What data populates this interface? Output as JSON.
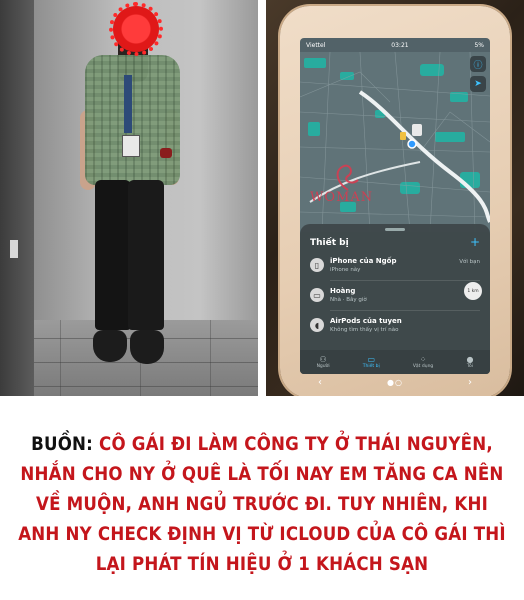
{
  "phone": {
    "status": {
      "carrier": "Viettel",
      "time": "03:21",
      "battery": "5%"
    },
    "map_watermark": "WOMAN",
    "panel": {
      "title": "Thiết bị",
      "add_icon": "plus-icon",
      "devices": [
        {
          "name": "iPhone của Ngốp",
          "sub": "iPhone này",
          "right": "Với bạn",
          "icon": "phone-icon"
        },
        {
          "name": "Hoàng",
          "sub": "Nhà · Bây giờ",
          "right": "",
          "icon": "macbook-icon"
        },
        {
          "name": "AirPods của tuyen",
          "sub": "Không tìm thấy vị trí nào",
          "right": "",
          "icon": "airpods-icon"
        }
      ],
      "distance": "1 km"
    },
    "tabs": [
      {
        "label": "Người",
        "icon": "people-icon",
        "active": false
      },
      {
        "label": "Thiết bị",
        "icon": "device-icon",
        "active": true
      },
      {
        "label": "Vật dụng",
        "icon": "item-icon",
        "active": false
      },
      {
        "label": "Tôi",
        "icon": "person-icon",
        "active": false
      }
    ]
  },
  "caption": {
    "lead": "BUỒN:",
    "body": "CÔ GÁI ĐI LÀM CÔNG TY Ở THÁI NGUYÊN, NHẮN CHO NY Ở QUÊ LÀ TỐI NAY EM TĂNG CA NÊN VỀ MUỘN, ANH NGỦ TRƯỚC ĐI. TUY NHIÊN, KHI ANH NY CHECK ĐỊNH VỊ TỪ ICLOUD CỦA CÔ GÁI THÌ LẠI PHÁT TÍN HIỆU Ở 1 KHÁCH SẠN"
  }
}
